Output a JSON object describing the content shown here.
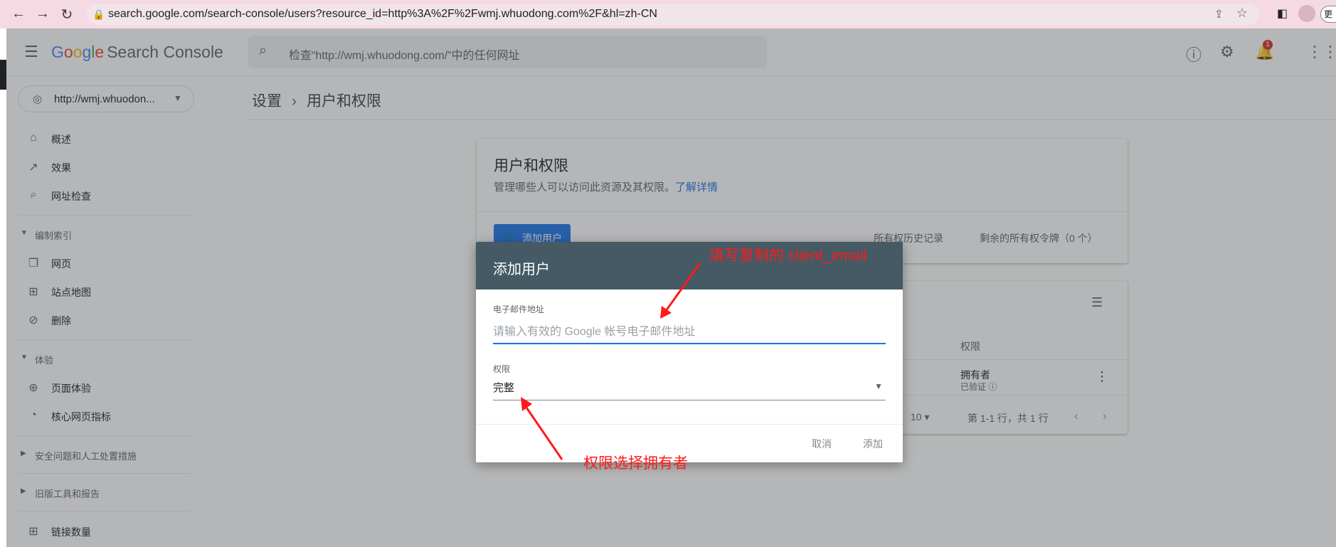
{
  "browser": {
    "url": "search.google.com/search-console/users?resource_id=http%3A%2F%2Fwmj.whuodong.com%2F&hl=zh-CN",
    "more_label": "更"
  },
  "app": {
    "logo_google": [
      "G",
      "o",
      "o",
      "g",
      "l",
      "e"
    ],
    "logo_product": "Search Console",
    "search_placeholder": "检查“http://wmj.whuodong.com/”中的任何网址",
    "notification_count": "1"
  },
  "sidebar": {
    "property": "http://wmj.whuodon...",
    "items": [
      {
        "label": "概述",
        "icon": "home-icon"
      },
      {
        "label": "效果",
        "icon": "trending-up-icon"
      },
      {
        "label": "网址检查",
        "icon": "search-icon"
      }
    ],
    "index_header": "编制索引",
    "index_items": [
      {
        "label": "网页",
        "icon": "pages-icon"
      },
      {
        "label": "站点地图",
        "icon": "sitemap-icon"
      },
      {
        "label": "删除",
        "icon": "visibility-off-icon"
      }
    ],
    "experience_header": "体验",
    "experience_items": [
      {
        "label": "页面体验",
        "icon": "add-circle-icon"
      },
      {
        "label": "核心网页指标",
        "icon": "speed-icon"
      }
    ],
    "security_header": "安全问题和人工处置措施",
    "legacy_header": "旧版工具和报告",
    "links_item": "链接数量"
  },
  "breadcrumb": {
    "parent": "设置",
    "current": "用户和权限"
  },
  "card": {
    "title": "用户和权限",
    "description": "管理哪些人可以访问此资源及其权限。",
    "learn_more": "了解详情",
    "add_user": "添加用户",
    "history_link": "所有权历史记录",
    "tokens_link": "剩余的所有权令牌（0 个）"
  },
  "table": {
    "column_permission": "权限",
    "row_permission": "拥有者",
    "row_status": "已验证 ⓘ",
    "rows_per_page": "10",
    "range": "第 1-1 行，共 1 行"
  },
  "dialog": {
    "title": "添加用户",
    "email_label": "电子邮件地址",
    "email_placeholder": "请输入有效的 Google 帐号电子邮件地址",
    "email_value": "",
    "permission_label": "权限",
    "permission_value": "完整",
    "cancel": "取消",
    "add": "添加"
  },
  "annotations": {
    "email_hint": "填写复制的 client_email",
    "permission_hint": "权限选择拥有者"
  },
  "colors": {
    "dialog_header": "#455a64",
    "accent": "#1a73e8",
    "annotation": "#ff1a1a"
  }
}
